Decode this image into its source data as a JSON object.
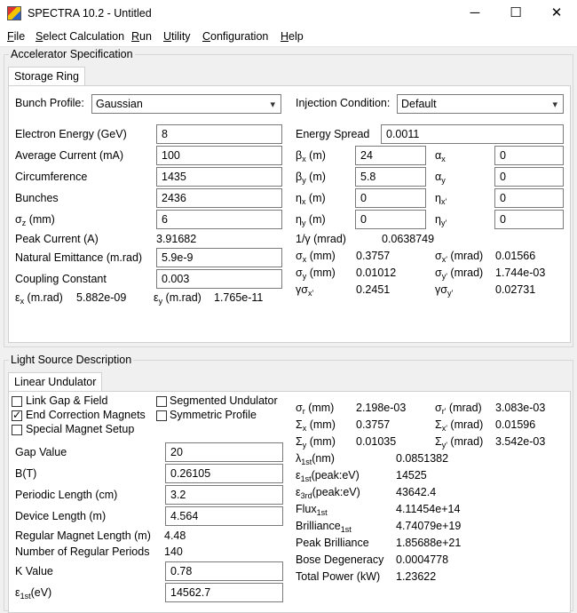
{
  "window": {
    "title": "SPECTRA 10.2 - Untitled",
    "minimize": "─",
    "maximize": "☐",
    "close": "✕"
  },
  "menu": [
    {
      "label": "File",
      "ul": "F",
      "rest": "ile"
    },
    {
      "label": "Select Calculation",
      "ul": "S",
      "rest": "elect Calculation"
    },
    {
      "label": "Run",
      "ul": "R",
      "rest": "un"
    },
    {
      "label": "Utility",
      "ul": "U",
      "rest": "tility"
    },
    {
      "label": "Configuration",
      "ul": "C",
      "rest": "onfiguration"
    },
    {
      "label": "Help",
      "ul": "H",
      "rest": "elp"
    }
  ],
  "accel": {
    "group_title": "Accelerator Specification",
    "tab": "Storage Ring",
    "bunch_profile_label": "Bunch Profile:",
    "bunch_profile_value": "Gaussian",
    "injection_label": "Injection Condition:",
    "injection_value": "Default",
    "energy_label": "Electron Energy (GeV)",
    "energy": "8",
    "current_label": "Average Current (mA)",
    "current": "100",
    "circ_label": "Circumference",
    "circ": "1435",
    "bunches_label": "Bunches",
    "bunches": "2436",
    "sigz_sym": "σ",
    "sigz_sub": "z",
    "sigz_unit": " (mm)",
    "sigz": "6",
    "peak_label": "Peak Current (A)",
    "peak": "3.91682",
    "emit_label": "Natural Emittance (m.rad)",
    "emit": "5.9e-9",
    "coupling_label": "Coupling Constant",
    "coupling": "0.003",
    "ex_sym": "ε",
    "ex_sub": "x",
    "ex_unit": " (m.rad)",
    "ex": "5.882e-09",
    "ey_sym": "ε",
    "ey_sub": "y",
    "ey_unit": " (m.rad)",
    "ey": "1.765e-11",
    "espread_label": "Energy Spread",
    "espread": "0.0011",
    "betax_sym": "β",
    "betax_sub": "x",
    "betax_unit": " (m)",
    "betax": "24",
    "betay_sym": "β",
    "betay_sub": "y",
    "betay_unit": " (m)",
    "betay": "5.8",
    "etax_sym": "η",
    "etax_sub": "x",
    "etax_unit": " (m)",
    "etax": "0",
    "etay_sym": "η",
    "etay_sub": "y",
    "etay_unit": " (m)",
    "etay": "0",
    "alphax_sym": "α",
    "alphax_sub": "x",
    "alphax": "0",
    "alphay_sym": "α",
    "alphay_sub": "y",
    "alphay": "0",
    "etaxp_sym": "η",
    "etaxp_sub": "x'",
    "etaxp": "0",
    "etayp_sym": "η",
    "etayp_sub": "y'",
    "etayp": "0",
    "invgamma_label": "1/γ (mrad)",
    "invgamma": "0.0638749",
    "sx_sym": "σ",
    "sx_sub": "x",
    "sx_unit": " (mm)",
    "sx": "0.3757",
    "sy_sym": "σ",
    "sy_sub": "y",
    "sy_unit": " (mm)",
    "sy": "0.01012",
    "gsx_sym": "γσ",
    "gsx_sub": "x'",
    "gsx": "0.2451",
    "sxp_sym": "σ",
    "sxp_sub": "x'",
    "sxp_unit": " (mrad)",
    "sxp": "0.01566",
    "syp_sym": "σ",
    "syp_sub": "y'",
    "syp_unit": " (mrad)",
    "syp": "1.744e-03",
    "gsy_sym": "γσ",
    "gsy_sub": "y'",
    "gsy": "0.02731"
  },
  "light": {
    "group_title": "Light Source Description",
    "tab": "Linear Undulator",
    "chk_linkgap": "Link Gap & Field",
    "chk_linkgap_on": false,
    "chk_endcorr": "End Correction Magnets",
    "chk_endcorr_on": true,
    "chk_special": "Special Magnet Setup",
    "chk_special_on": false,
    "chk_segmented": "Segmented Undulator",
    "chk_segmented_on": false,
    "chk_symmetric": "Symmetric Profile",
    "chk_symmetric_on": false,
    "gap_label": "Gap Value",
    "gap": "20",
    "b_label": "B(T)",
    "b": "0.26105",
    "period_label": "Periodic Length (cm)",
    "period": "3.2",
    "devlen_label": "Device Length (m)",
    "devlen": "4.564",
    "regmag_label": "Regular Magnet Length (m)",
    "regmag": "4.48",
    "nreg_label": "Number of Regular Periods",
    "nreg": "140",
    "k_label": "K Value",
    "k": "0.78",
    "e1st_sym": "ε",
    "e1st_sub": "1st",
    "e1st_unit": "(eV)",
    "e1st": "14562.7",
    "sr_sym": "σ",
    "sr_sub": "r",
    "sr_unit": " (mm)",
    "sr": "2.198e-03",
    "Sx_sym": "Σ",
    "Sx_sub": "x",
    "Sx_unit": " (mm)",
    "Sx": "0.3757",
    "Sy_sym": "Σ",
    "Sy_sub": "y",
    "Sy_unit": " (mm)",
    "Sy": "0.01035",
    "srp_sym": "σ",
    "srp_sub": "r'",
    "srp_unit": " (mrad)",
    "srp": "3.083e-03",
    "Sxp_sym": "Σ",
    "Sxp_sub": "x'",
    "Sxp_unit": " (mrad)",
    "Sxp": "0.01596",
    "Syp_sym": "Σ",
    "Syp_sub": "y'",
    "Syp_unit": " (mrad)",
    "Syp": "3.542e-03",
    "lambda_sym": "λ",
    "lambda_sub": "1st",
    "lambda_unit": "(nm)",
    "lambda": "0.0851382",
    "e1p_sym": "ε",
    "e1p_sub": "1st",
    "e1p_unit": "(peak:eV)",
    "e1p": "14525",
    "e3p_sym": "ε",
    "e3p_sub": "3rd",
    "e3p_unit": "(peak:eV)",
    "e3p": "43642.4",
    "flux_label": "Flux",
    "flux_sub": "1st",
    "flux": "4.11454e+14",
    "bril_label": "Brilliance",
    "bril_sub": "1st",
    "bril": "4.74079e+19",
    "peakbril_label": "Peak Brilliance",
    "peakbril": "1.85688e+21",
    "bose_label": "Bose Degeneracy",
    "bose": "0.0004778",
    "power_label": "Total Power (kW)",
    "power": "1.23622"
  }
}
